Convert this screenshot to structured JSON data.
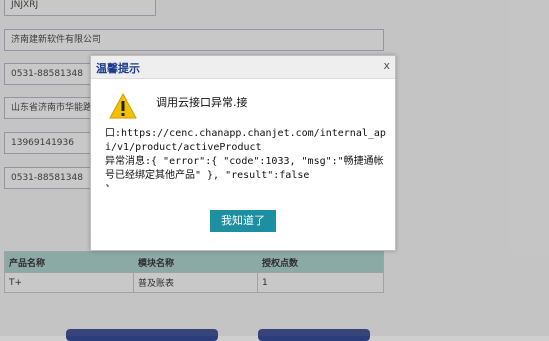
{
  "form": {
    "field1": "JNJXRJ",
    "field2": "济南建新软件有限公司",
    "field3": "0531-88581348",
    "field4": "山东省济南市华能路",
    "field5": "13969141936",
    "field6": "0531-88581348"
  },
  "table": {
    "headers": [
      "产品名称",
      "模块名称",
      "授权点数"
    ],
    "rows": [
      [
        "T+",
        "普及账表",
        "1"
      ]
    ]
  },
  "dialog": {
    "title": "温馨提示",
    "close": "x",
    "message_line1": "调用云接口异常.接",
    "message_body": "口:https://cenc.chanapp.chanjet.com/internal_api/v1/product/activeProduct\n异常消息:{ \"error\":{ \"code\":1033, \"msg\":\"畅捷通帐号已经绑定其他产品\" }, \"result\":false\n}",
    "ok_label": "我知道了",
    "icon": "warning-icon"
  },
  "colors": {
    "accent": "#1d8fa0",
    "title": "#1a3b8c",
    "table_header": "#8fb2ad"
  }
}
